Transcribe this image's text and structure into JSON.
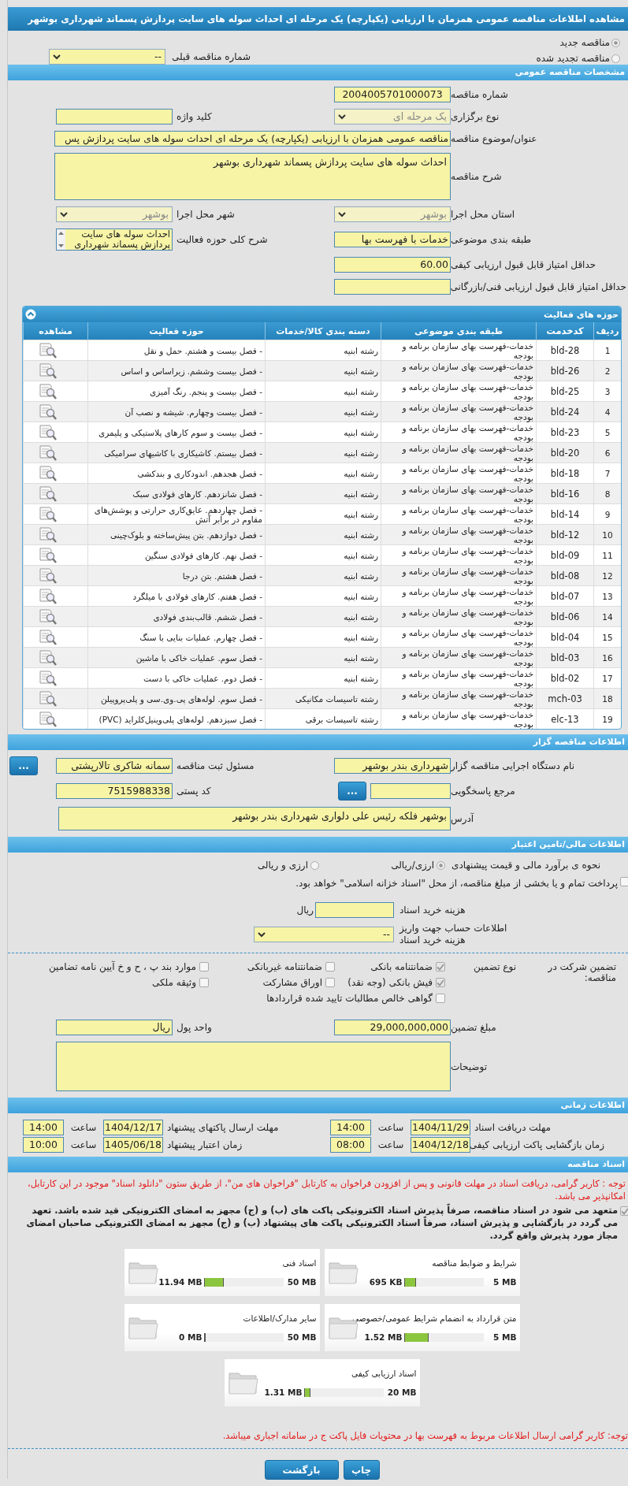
{
  "page_title": "مشاهده اطلاعات مناقصه عمومی همزمان با ارزیابی (یکپارچه) یک مرحله ای احداث سوله های سایت پردازش پسماند شهرداری بوشهر",
  "tender_kind": [
    {
      "label": "مناقصه جدید",
      "selected": true
    },
    {
      "label": "مناقصه تجدید شده",
      "selected": false
    }
  ],
  "previous_tender": {
    "label": "شماره مناقصه قبلی",
    "value": "--"
  },
  "general": {
    "title": "مشخصات مناقصه عمومی",
    "rows": [
      {
        "right": {
          "label": "شماره مناقصه",
          "value": "2004005701000073",
          "kind": "centered"
        }
      },
      {
        "right": {
          "label": "نوع برگزاری",
          "value": "یک مرحله ای",
          "kind": "select",
          "disabled": true
        },
        "left": {
          "label": "کلید واژه",
          "kind": "text"
        }
      },
      {
        "right": {
          "label": "عنوان/موضوع مناقصه",
          "value": "مناقصه عمومی همزمان با ارزیابی (یکپارچه) یک مرحله ای احداث سوله های سایت پردازش پس",
          "kind": "wide"
        }
      },
      {
        "right": {
          "label": "شرح مناقصه",
          "value": "احداث سوله های سایت پردازش پسماند شهرداری بوشهر",
          "kind": "textarea"
        }
      },
      {
        "right": {
          "label": "استان محل اجرا",
          "value": "بوشهر",
          "kind": "select",
          "disabled": true
        },
        "left": {
          "label": "شهر محل اجرا",
          "value": "بوشهر",
          "kind": "select",
          "disabled": true
        }
      },
      {
        "right": {
          "label": "طبقه بندی موضوعی",
          "value": "خدمات با فهرست بها",
          "kind": "text"
        },
        "left": {
          "label": "شرح کلی حوزه فعالیت",
          "value": "احداث سوله های سایت پردازش پسماند شهرداری",
          "kind": "listbox"
        }
      },
      {
        "right": {
          "label": "حداقل امتیاز قابل قبول ارزیابی کیفی",
          "value": "60.00",
          "kind": "text"
        }
      },
      {
        "right": {
          "label": "حداقل امتیاز قابل قبول ارزیابی فنی/بازرگانی",
          "kind": "text"
        }
      }
    ]
  },
  "activities": {
    "title": "حوزه های فعالیت",
    "expanded": true,
    "columns": [
      "ردیف",
      "کدخدمت",
      "طبقه بندی موضوعی",
      "دسته بندی کالا/خدمات",
      "حوزه فعالیت",
      "مشاهده"
    ],
    "rows": [
      [
        "1",
        "bld-28",
        "خدمات-فهرست بهای سازمان برنامه و بودجه",
        "رشته ابنیه",
        "- فصل بیست و هشتم. حمل و نقل"
      ],
      [
        "2",
        "bld-26",
        "خدمات-فهرست بهای سازمان برنامه و بودجه",
        "رشته ابنیه",
        "- فصل بیست وششم. زیراساس و اساس"
      ],
      [
        "3",
        "bld-25",
        "خدمات-فهرست بهای سازمان برنامه و بودجه",
        "رشته ابنیه",
        "- فصل بیست و پنجم. رنگ آمیزی"
      ],
      [
        "4",
        "bld-24",
        "خدمات-فهرست بهای سازمان برنامه و بودجه",
        "رشته ابنیه",
        "- فصل بیست وچهارم. شیشه و نصب آن"
      ],
      [
        "5",
        "bld-23",
        "خدمات-فهرست بهای سازمان برنامه و بودجه",
        "رشته ابنیه",
        "- فصل بیست و سوم کارهای پلاستیکی و پلیمری"
      ],
      [
        "6",
        "bld-20",
        "خدمات-فهرست بهای سازمان برنامه و بودجه",
        "رشته ابنیه",
        "- فصل بیستم. کاشیکاری با کاشیهای سرامیکی"
      ],
      [
        "7",
        "bld-18",
        "خدمات-فهرست بهای سازمان برنامه و بودجه",
        "رشته ابنیه",
        "- فصل هجدهم. اندودکاری و بندکشی"
      ],
      [
        "8",
        "bld-16",
        "خدمات-فهرست بهای سازمان برنامه و بودجه",
        "رشته ابنیه",
        "- فصل شانزدهم. کارهای فولادی سبک"
      ],
      [
        "9",
        "bld-14",
        "خدمات-فهرست بهای سازمان برنامه و بودجه",
        "رشته ابنیه",
        "- فصل چهاردهم. عایق‌کاری حرارتی و پوشش‌های مقاوم در برابر آتش"
      ],
      [
        "10",
        "bld-12",
        "خدمات-فهرست بهای سازمان برنامه و بودجه",
        "رشته ابنیه",
        "- فصل دوازدهم. بتن پیش‌ساخته و بلوک‌چینی"
      ],
      [
        "11",
        "bld-09",
        "خدمات-فهرست بهای سازمان برنامه و بودجه",
        "رشته ابنیه",
        "- فصل نهم. کارهای فولادی سنگین"
      ],
      [
        "12",
        "bld-08",
        "خدمات-فهرست بهای سازمان برنامه و بودجه",
        "رشته ابنیه",
        "- فصل هشتم. بتن درجا"
      ],
      [
        "13",
        "bld-07",
        "خدمات-فهرست بهای سازمان برنامه و بودجه",
        "رشته ابنیه",
        "- فصل هفتم. کارهای فولادی با میلگرد"
      ],
      [
        "14",
        "bld-06",
        "خدمات-فهرست بهای سازمان برنامه و بودجه",
        "رشته ابنیه",
        "- فصل ششم. قالب‌بندی فولادی"
      ],
      [
        "15",
        "bld-04",
        "خدمات-فهرست بهای سازمان برنامه و بودجه",
        "رشته ابنیه",
        "- فصل چهارم. عملیات بنایی با سنگ"
      ],
      [
        "16",
        "bld-03",
        "خدمات-فهرست بهای سازمان برنامه و بودجه",
        "رشته ابنیه",
        "- فصل سوم. عملیات خاکی با ماشین"
      ],
      [
        "17",
        "bld-02",
        "خدمات-فهرست بهای سازمان برنامه و بودجه",
        "رشته ابنیه",
        "- فصل دوم. عملیات خاکی با دست"
      ],
      [
        "18",
        "mch-03",
        "خدمات-فهرست بهای سازمان برنامه و بودجه",
        "رشته تاسیسات مکانیکی",
        "- فصل سوم. لوله‌های پی.وی.سی و پلی‌پروپیلن"
      ],
      [
        "19",
        "elc-13",
        "خدمات-فهرست بهای سازمان برنامه و بودجه",
        "رشته تاسیسات برقی",
        "- فصل سیزدهم. لوله‌های پلی‌وینیل‌کلراید (PVC)"
      ]
    ]
  },
  "organizer": {
    "title": "اطلاعات مناقصه گزار",
    "rows": [
      {
        "right": {
          "label": "نام دستگاه اجرایی مناقصه گزار",
          "value": "شهرداری بندر بوشهر",
          "kind": "text"
        },
        "left": {
          "label": "مسئول ثبت مناقصه",
          "value": "سمانه شاکری تالارپشتی",
          "kind": "text",
          "button": "..."
        }
      },
      {
        "right": {
          "label": "مرجع پاسخگویی",
          "kind": "text",
          "button": "..."
        },
        "left": {
          "label": "کد پستی",
          "value": "7515988338",
          "kind": "text"
        }
      },
      {
        "right": {
          "label": "آدرس",
          "value": "بوشهر فلکه رئیس علی دلواری شهرداری بندر بوشهر",
          "kind": "address"
        }
      }
    ]
  },
  "finance": {
    "title": "اطلاعات مالی/تامین اعتبار",
    "estimate": {
      "label": "نحوه ی برآورد مالی و قیمت پیشنهادی",
      "options": [
        {
          "label": "ارزی/ریالی",
          "selected": true
        },
        {
          "label": "ارزی و ریالی",
          "selected": false
        }
      ]
    },
    "treasury": {
      "label": "پرداخت تمام و یا بخشی از مبلغ مناقصه، از محل \"اسناد خزانه اسلامی\" خواهد بود.",
      "checked": false
    },
    "doc_fee": {
      "label": "هزینه خرید اسناد",
      "unit": "ریال"
    },
    "account": {
      "label": "اطلاعات حساب جهت واریز هزینه خرید اسناد",
      "value": "--"
    }
  },
  "guarantee": {
    "label": "تضمین شرکت در مناقصه:",
    "type_label": "نوع تضمین",
    "options": [
      {
        "label": "ضمانتنامه بانکی",
        "checked": true
      },
      {
        "label": "ضمانتنامه غیربانکی",
        "checked": false
      },
      {
        "label": "موارد بند پ ، ح و خ آیین نامه تضامین",
        "checked": false
      },
      {
        "label": "فیش بانکی (وجه نقد)",
        "checked": true
      },
      {
        "label": "اوراق مشارکت",
        "checked": false
      },
      {
        "label": "وثیقه ملکی",
        "checked": false
      },
      {
        "label": "گواهی خالص مطالبات تایید شده قراردادها",
        "checked": false
      }
    ],
    "amount": {
      "label": "مبلغ تضمین",
      "value": "29,000,000,000"
    },
    "currency": {
      "label": "واحد پول",
      "value": "ریال"
    },
    "notes": {
      "label": "توضیحات"
    }
  },
  "timing": {
    "title": "اطلاعات زمانی",
    "rows": [
      [
        {
          "label": "مهلت دریافت اسناد",
          "date": "1404/11/29",
          "time_label": "ساعت",
          "time": "14:00"
        },
        {
          "label": "مهلت ارسال پاکتهای پیشنهاد",
          "date": "1404/12/17",
          "time_label": "ساعت",
          "time": "14:00"
        }
      ],
      [
        {
          "label": "زمان بازگشایی پاکت ارزیابی کیفی",
          "date": "1404/12/18",
          "time_label": "ساعت",
          "time": "08:00"
        },
        {
          "label": "زمان اعتبار پیشنهاد",
          "date": "1405/06/18",
          "time_label": "ساعت",
          "time": "10:00"
        }
      ]
    ]
  },
  "documents": {
    "title": "اسناد مناقصه",
    "notice": "توجه : کاربر گرامی، دریافت اسناد در مهلت قانونی و پس از افزودن فراخوان به کارتابل \"فراخوان های من\"، از طریق ستون \"دانلود اسناد\" موجود در این کارتابل، امکانپذیر می باشد.",
    "commitment": {
      "text": "متعهد می شود در اسناد مناقصه، صرفاً پذیرش اسناد الکترونیکی پاکت های (ب) و (ج) مجهز به امضای الکترونیکی قید شده باشد. تعهد می گردد در بازگشایی و پذیرش اسناد، صرفاً اسناد الکترونیکی پاکت های پیشنهاد (ب) و (ج) مجهز به امضای الکترونیکی صاحبان امضای مجاز مورد پذیرش واقع گردد.",
      "checked": true
    },
    "files": [
      {
        "name": "شرایط و ضوابط مناقصه",
        "used": "695 KB",
        "max": "5 MB",
        "level": 0.14
      },
      {
        "name": "اسناد فنی",
        "used": "11.94 MB",
        "max": "50 MB",
        "level": 0.24
      },
      {
        "name": "متن قرارداد به انضمام شرایط عمومی/خصوصی",
        "used": "1.52 MB",
        "max": "5 MB",
        "level": 0.3
      },
      {
        "name": "سایر مدارک/اطلاعات",
        "used": "0 MB",
        "max": "50 MB",
        "level": 0
      },
      {
        "name": "اسناد ارزیابی کیفی",
        "used": "1.31 MB",
        "max": "20 MB",
        "level": 0.07
      }
    ],
    "footer_notice": "توجه: کاربر گرامی ارسال اطلاعات مربوط به فهرست بها در محتویات فایل پاکت ج در سامانه اجباری میباشد."
  },
  "buttons": [
    "چاپ",
    "بازگشت"
  ]
}
